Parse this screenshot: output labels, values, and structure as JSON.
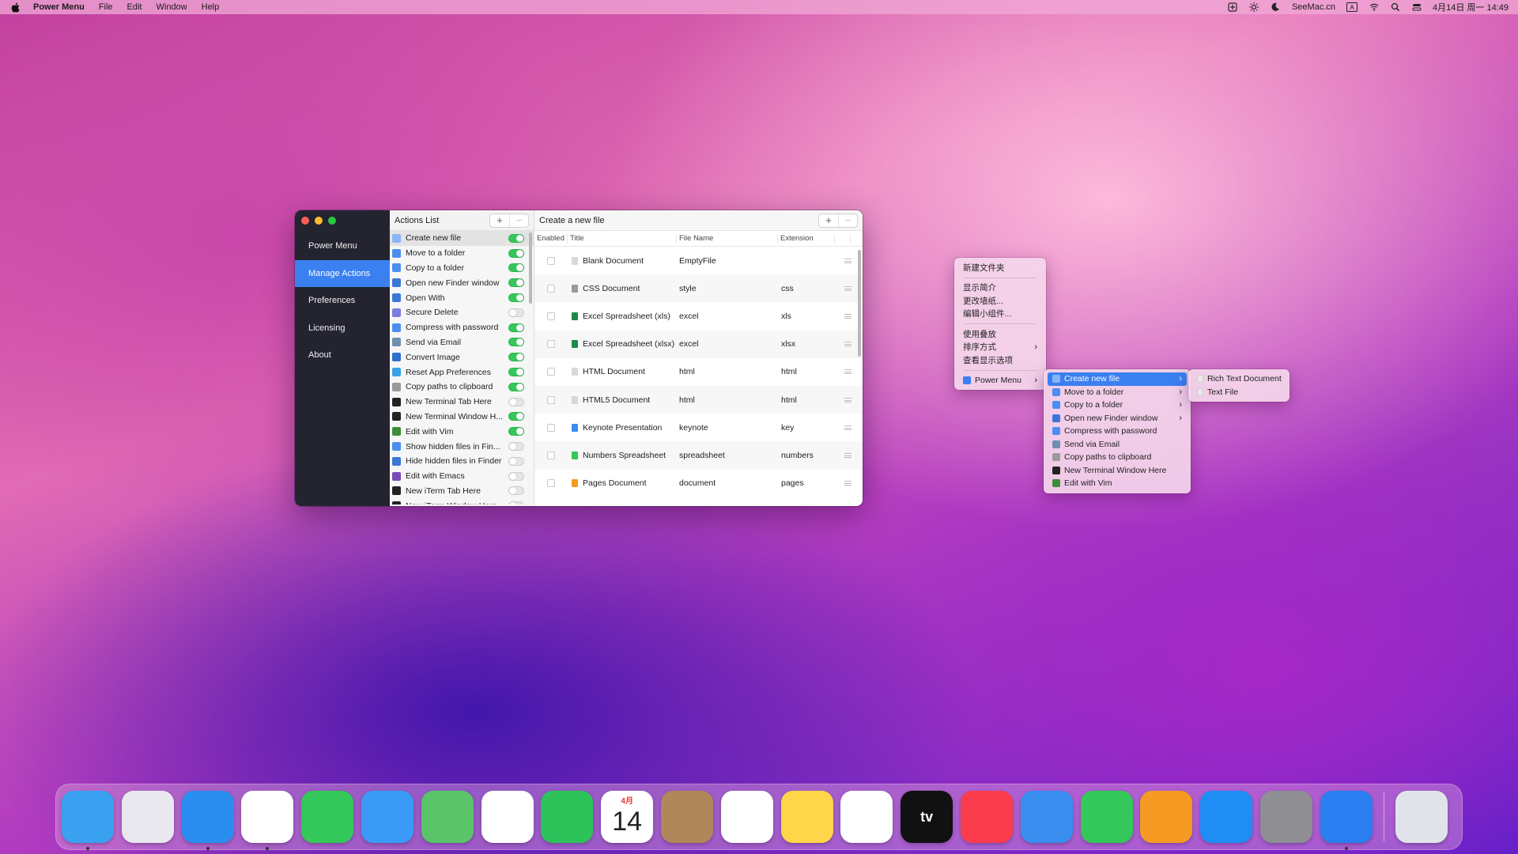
{
  "menubar": {
    "app_name": "Power Menu",
    "menus": [
      "File",
      "Edit",
      "Window",
      "Help"
    ],
    "brand": "SeeMac.cn",
    "input_method": "A",
    "datetime": "4月14日 周一 14:49"
  },
  "window": {
    "sidebar": {
      "items": [
        {
          "label": "Power Menu",
          "active": false
        },
        {
          "label": "Manage Actions",
          "active": true
        },
        {
          "label": "Preferences",
          "active": false
        },
        {
          "label": "Licensing",
          "active": false
        },
        {
          "label": "About",
          "active": false
        }
      ]
    },
    "actions": {
      "title": "Actions List",
      "add": "+",
      "remove": "−",
      "items": [
        {
          "label": "Create new file",
          "on": true,
          "color": "#8ab4f8"
        },
        {
          "label": "Move to a folder",
          "on": true,
          "color": "#4a8ff0"
        },
        {
          "label": "Copy to a folder",
          "on": true,
          "color": "#4a8ff0"
        },
        {
          "label": "Open new Finder window",
          "on": true,
          "color": "#3a78d8"
        },
        {
          "label": "Open With",
          "on": true,
          "color": "#3a78d8"
        },
        {
          "label": "Secure Delete",
          "on": false,
          "color": "#7c7ce0"
        },
        {
          "label": "Compress with password",
          "on": true,
          "color": "#4a8ff0"
        },
        {
          "label": "Send via Email",
          "on": true,
          "color": "#6e8fb0"
        },
        {
          "label": "Convert Image",
          "on": true,
          "color": "#2e6fd0"
        },
        {
          "label": "Reset App Preferences",
          "on": true,
          "color": "#3aa0e8"
        },
        {
          "label": "Copy paths to clipboard",
          "on": true,
          "color": "#9a9a9a"
        },
        {
          "label": "New Terminal Tab Here",
          "on": false,
          "color": "#222222"
        },
        {
          "label": "New Terminal Window H...",
          "on": true,
          "color": "#222222"
        },
        {
          "label": "Edit with Vim",
          "on": true,
          "color": "#3c8c3c"
        },
        {
          "label": "Show hidden files in Fin...",
          "on": false,
          "color": "#4a8ff0"
        },
        {
          "label": "Hide hidden files in Finder",
          "on": false,
          "color": "#3a78d8"
        },
        {
          "label": "Edit with Emacs",
          "on": false,
          "color": "#7a4ab8"
        },
        {
          "label": "New iTerm Tab Here",
          "on": false,
          "color": "#222222"
        },
        {
          "label": "New iTerm Window Here",
          "on": false,
          "color": "#222222"
        }
      ]
    },
    "main": {
      "title": "Create a new file",
      "add": "+",
      "remove": "−",
      "columns": {
        "enabled": "Enabled",
        "title": "Title",
        "file_name": "File Name",
        "extension": "Extension"
      },
      "rows": [
        {
          "title": "Blank Document",
          "file": "EmptyFile",
          "ext": "",
          "color": "#d8d8d8"
        },
        {
          "title": "CSS Document",
          "file": "style",
          "ext": "css",
          "color": "#9a9a9a"
        },
        {
          "title": "Excel Spreadsheet (xls)",
          "file": "excel",
          "ext": "xls",
          "color": "#1f8a4c"
        },
        {
          "title": "Excel Spreadsheet (xlsx)",
          "file": "excel",
          "ext": "xlsx",
          "color": "#1f8a4c"
        },
        {
          "title": "HTML Document",
          "file": "html",
          "ext": "html",
          "color": "#d8d8d8"
        },
        {
          "title": "HTML5 Document",
          "file": "html",
          "ext": "html",
          "color": "#d8d8d8"
        },
        {
          "title": "Keynote Presentation",
          "file": "keynote",
          "ext": "key",
          "color": "#3a8ef0"
        },
        {
          "title": "Numbers Spreadsheet",
          "file": "spreadsheet",
          "ext": "numbers",
          "color": "#34c759"
        },
        {
          "title": "Pages Document",
          "file": "document",
          "ext": "pages",
          "color": "#f59a23"
        }
      ]
    }
  },
  "context_menu": {
    "groups": [
      [
        "新建文件夹"
      ],
      [
        "显示简介",
        "更改墙纸...",
        "编辑小组件..."
      ],
      [
        "使用叠放",
        "排序方式",
        "查看显示选项"
      ]
    ],
    "power_menu": "Power Menu",
    "submenu": [
      {
        "label": "Create new file",
        "arrow": true,
        "highlight": true,
        "color": "#8ab4f8"
      },
      {
        "label": "Move to a folder",
        "arrow": true,
        "color": "#4a8ff0"
      },
      {
        "label": "Copy to a folder",
        "arrow": true,
        "color": "#4a8ff0"
      },
      {
        "label": "Open new Finder window",
        "arrow": true,
        "color": "#3a78d8"
      },
      {
        "label": "Compress with password",
        "arrow": false,
        "color": "#4a8ff0"
      },
      {
        "label": "Send via Email",
        "arrow": false,
        "color": "#6e8fb0"
      },
      {
        "label": "Copy paths to clipboard",
        "arrow": false,
        "color": "#9a9a9a"
      },
      {
        "label": "New Terminal Window Here",
        "arrow": false,
        "color": "#222222"
      },
      {
        "label": "Edit with Vim",
        "arrow": false,
        "color": "#3c8c3c"
      }
    ],
    "file_submenu": [
      "Rich Text Document",
      "Text File"
    ]
  },
  "dock": {
    "apps": [
      {
        "name": "finder-app",
        "color": "#3aa0f0",
        "running": true
      },
      {
        "name": "launchpad-app",
        "color": "#e8e8ee",
        "running": false
      },
      {
        "name": "safari-app",
        "color": "#2a8ef0",
        "running": true
      },
      {
        "name": "chrome-app",
        "color": "#ffffff",
        "running": true
      },
      {
        "name": "messages-app",
        "color": "#34c759",
        "running": false
      },
      {
        "name": "mail-app",
        "color": "#3a9af5",
        "running": false
      },
      {
        "name": "maps-app",
        "color": "#5ac46a",
        "running": false
      },
      {
        "name": "photos-app",
        "color": "#ffffff",
        "running": false
      },
      {
        "name": "facetime-app",
        "color": "#2ec35a",
        "running": false
      },
      {
        "name": "calendar-app",
        "color": "#ffffff",
        "running": false
      },
      {
        "name": "contacts-app",
        "color": "#b0875a",
        "running": false
      },
      {
        "name": "reminders-app",
        "color": "#ffffff",
        "running": false
      },
      {
        "name": "notes-app",
        "color": "#ffd54a",
        "running": false
      },
      {
        "name": "freeform-app",
        "color": "#ffffff",
        "running": false
      },
      {
        "name": "tv-app",
        "color": "#111111",
        "running": false
      },
      {
        "name": "music-app",
        "color": "#fa3c4c",
        "running": false
      },
      {
        "name": "keynote-app",
        "color": "#3a8ef0",
        "running": false
      },
      {
        "name": "numbers-app",
        "color": "#34c759",
        "running": false
      },
      {
        "name": "pages-app",
        "color": "#f59a23",
        "running": false
      },
      {
        "name": "app-store-app",
        "color": "#1e8ef5",
        "running": false
      },
      {
        "name": "system-settings-app",
        "color": "#8e8e93",
        "running": false
      },
      {
        "name": "power-menu-app",
        "color": "#2a7ef0",
        "running": true
      }
    ],
    "calendar": {
      "month": "4月",
      "day": "14"
    },
    "tv_label": "tv",
    "trash": {
      "name": "trash",
      "color": "#e0e4ea"
    }
  }
}
